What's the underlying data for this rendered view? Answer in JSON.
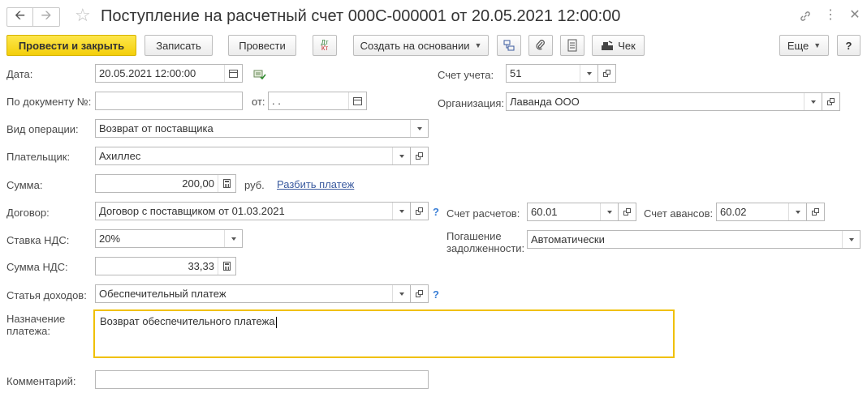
{
  "header": {
    "title": "Поступление на расчетный счет 000С-000001 от 20.05.2021 12:00:00",
    "icons": {
      "back": "arrow-left-icon",
      "forward": "arrow-right-icon",
      "favorite": "star-icon",
      "link": "link-icon",
      "more": "more-vertical-icon",
      "close": "close-icon"
    }
  },
  "toolbar": {
    "post_close": "Провести и закрыть",
    "save": "Записать",
    "post": "Провести",
    "dtkt": {
      "dt": "Дт",
      "kt": "Кт"
    },
    "create_based": "Создать на основании",
    "check": "Чек",
    "more": "Еще",
    "help": "?"
  },
  "form": {
    "date": {
      "label": "Дата:",
      "value": "20.05.2021 12:00:00"
    },
    "doc_number": {
      "label": "По документу №:",
      "value": "",
      "from_label": "от:",
      "from_value": " .  ."
    },
    "operation": {
      "label": "Вид операции:",
      "value": "Возврат от поставщика"
    },
    "payer": {
      "label": "Плательщик:",
      "value": "Ахиллес"
    },
    "amount": {
      "label": "Сумма:",
      "value": "200,00",
      "currency": "руб.",
      "split_link": "Разбить платеж"
    },
    "contract": {
      "label": "Договор:",
      "value": "Договор с поставщиком от 01.03.2021",
      "help": "?"
    },
    "vat_rate": {
      "label": "Ставка НДС:",
      "value": "20%"
    },
    "vat_amount": {
      "label": "Сумма НДС:",
      "value": "33,33"
    },
    "income_item": {
      "label": "Статья доходов:",
      "value": "Обеспечительный платеж",
      "help": "?"
    },
    "purpose": {
      "label": "Назначение платежа:",
      "value": "Возврат обеспечительного платежа"
    },
    "comment": {
      "label": "Комментарий:",
      "value": ""
    },
    "account": {
      "label": "Счет учета:",
      "value": "51"
    },
    "organization": {
      "label": "Организация:",
      "value": "Лаванда ООО"
    },
    "settlement_account": {
      "label": "Счет расчетов:",
      "value": "60.01"
    },
    "advance_account": {
      "label": "Счет авансов:",
      "value": "60.02"
    },
    "debt_repayment": {
      "label": "Погашение задолженности:",
      "value": "Автоматически"
    }
  },
  "colors": {
    "primary_button": "#f4cf0b",
    "focus_border": "#f0c000",
    "link": "#3a5a9f"
  }
}
